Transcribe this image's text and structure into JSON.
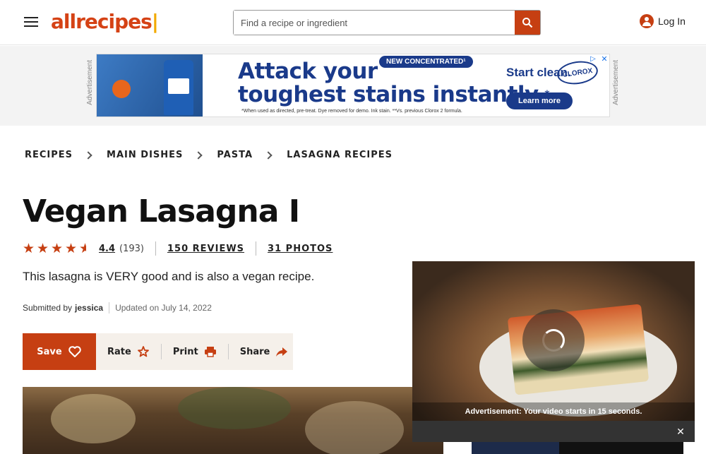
{
  "header": {
    "logo_text": "allrecipes",
    "logo_dot": "|",
    "search_placeholder": "Find a recipe or ingredient",
    "login_label": "Log In"
  },
  "ad": {
    "label_left": "Advertisement",
    "label_right": "Advertisement",
    "new_badge": "NEW CONCENTRATED¹",
    "headline_1": "Attack your",
    "headline_2": "toughest stains instantly.",
    "headline_mark": "*",
    "fine_print": "*When used as directed, pre-treat. Dye removed for demo. Ink stain. **Vs. previous Clorox 2 formula.",
    "start_clean": "Start clean.",
    "brand": "CLOROX",
    "learn_more": "Learn more"
  },
  "breadcrumbs": [
    "RECIPES",
    "MAIN DISHES",
    "PASTA",
    "LASAGNA RECIPES"
  ],
  "recipe": {
    "title": "Vegan Lasagna I",
    "rating": "4.4",
    "rating_count": "(193)",
    "reviews": "150 REVIEWS",
    "photos": "31 PHOTOS",
    "description": "This lasagna is VERY good and is also a vegan recipe.",
    "submitted_prefix": "Submitted by",
    "author": "jessica",
    "updated": "Updated on July 14, 2022"
  },
  "actions": {
    "save": "Save",
    "rate": "Rate",
    "print": "Print",
    "share": "Share"
  },
  "video": {
    "message": "Advertisement: Your video starts in 15 seconds.",
    "close": "✕"
  },
  "colors": {
    "brand": "#c63f12",
    "action_bar_bg": "#f5f0ea"
  }
}
